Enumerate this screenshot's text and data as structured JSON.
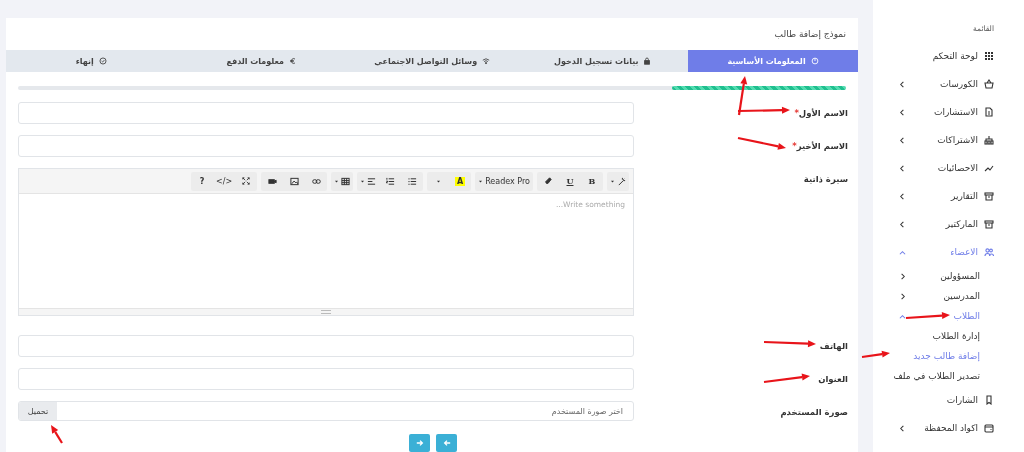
{
  "page_title": "نموذج إضافة طالب",
  "tabs": [
    {
      "label": "المعلومات الأساسية",
      "selected": true
    },
    {
      "label": "بيانات تسجيل الدخول",
      "selected": false
    },
    {
      "label": "وسائل التواصل الاجتماعي",
      "selected": false
    },
    {
      "label": "معلومات الدفع",
      "selected": false
    },
    {
      "label": "إنهاء",
      "selected": false
    }
  ],
  "progress": {
    "level": 0.21
  },
  "required_mark": "*",
  "fields": [
    {
      "kind": "text",
      "label": "الاسم الأول",
      "required": true
    },
    {
      "kind": "text",
      "label": "الاسم الأخير",
      "required": true
    },
    {
      "kind": "editor",
      "label": "سيرة ذاتية",
      "required": false,
      "placeholder": "Write something...",
      "toolbar": {
        "bold": "B",
        "underline": "U",
        "font": "Readex Pro",
        "highlight": "A",
        "code": "</>",
        "help": "?"
      }
    },
    {
      "kind": "text",
      "label": "الهاتف",
      "required": false
    },
    {
      "kind": "text",
      "label": "العنوان",
      "required": false
    },
    {
      "kind": "file",
      "label": "صورة المستخدم",
      "required": false,
      "placeholder": "اختر صورة المستخدم",
      "button": "تحميل"
    }
  ],
  "sidebar": {
    "heading": "القائمة",
    "items": [
      {
        "label": "لوحة التحكم",
        "expandable": false,
        "expanded": false,
        "selected": false
      },
      {
        "label": "الكورسات",
        "expandable": true,
        "expanded": false,
        "selected": false
      },
      {
        "label": "الاستشارات",
        "expandable": true,
        "expanded": false,
        "selected": false
      },
      {
        "label": "الاشتراكات",
        "expandable": true,
        "expanded": false,
        "selected": false
      },
      {
        "label": "الاحصائيات",
        "expandable": true,
        "expanded": false,
        "selected": false
      },
      {
        "label": "التقارير",
        "expandable": true,
        "expanded": false,
        "selected": false
      },
      {
        "label": "الماركتير",
        "expandable": true,
        "expanded": false,
        "selected": false
      },
      {
        "label": "الاعضاء",
        "expandable": true,
        "expanded": true,
        "selected": true,
        "children": [
          {
            "label": "المسؤولين",
            "expandable": true,
            "expanded": false,
            "selected": false
          },
          {
            "label": "المدرسين",
            "expandable": true,
            "expanded": false,
            "selected": false
          },
          {
            "label": "الطلاب",
            "expandable": true,
            "expanded": true,
            "selected": true,
            "children": [
              {
                "label": "إدارة الطلاب",
                "expandable": false,
                "expanded": false,
                "selected": false
              },
              {
                "label": "إضافة طالب جديد",
                "expandable": false,
                "expanded": false,
                "selected": true
              },
              {
                "label": "تصدير الطلاب في ملف",
                "expandable": false,
                "expanded": false,
                "selected": false
              }
            ]
          }
        ]
      },
      {
        "label": "الشارات",
        "expandable": false,
        "expanded": false,
        "selected": false
      },
      {
        "label": "اكواد المحفظة",
        "expandable": true,
        "expanded": false,
        "selected": false
      }
    ]
  }
}
